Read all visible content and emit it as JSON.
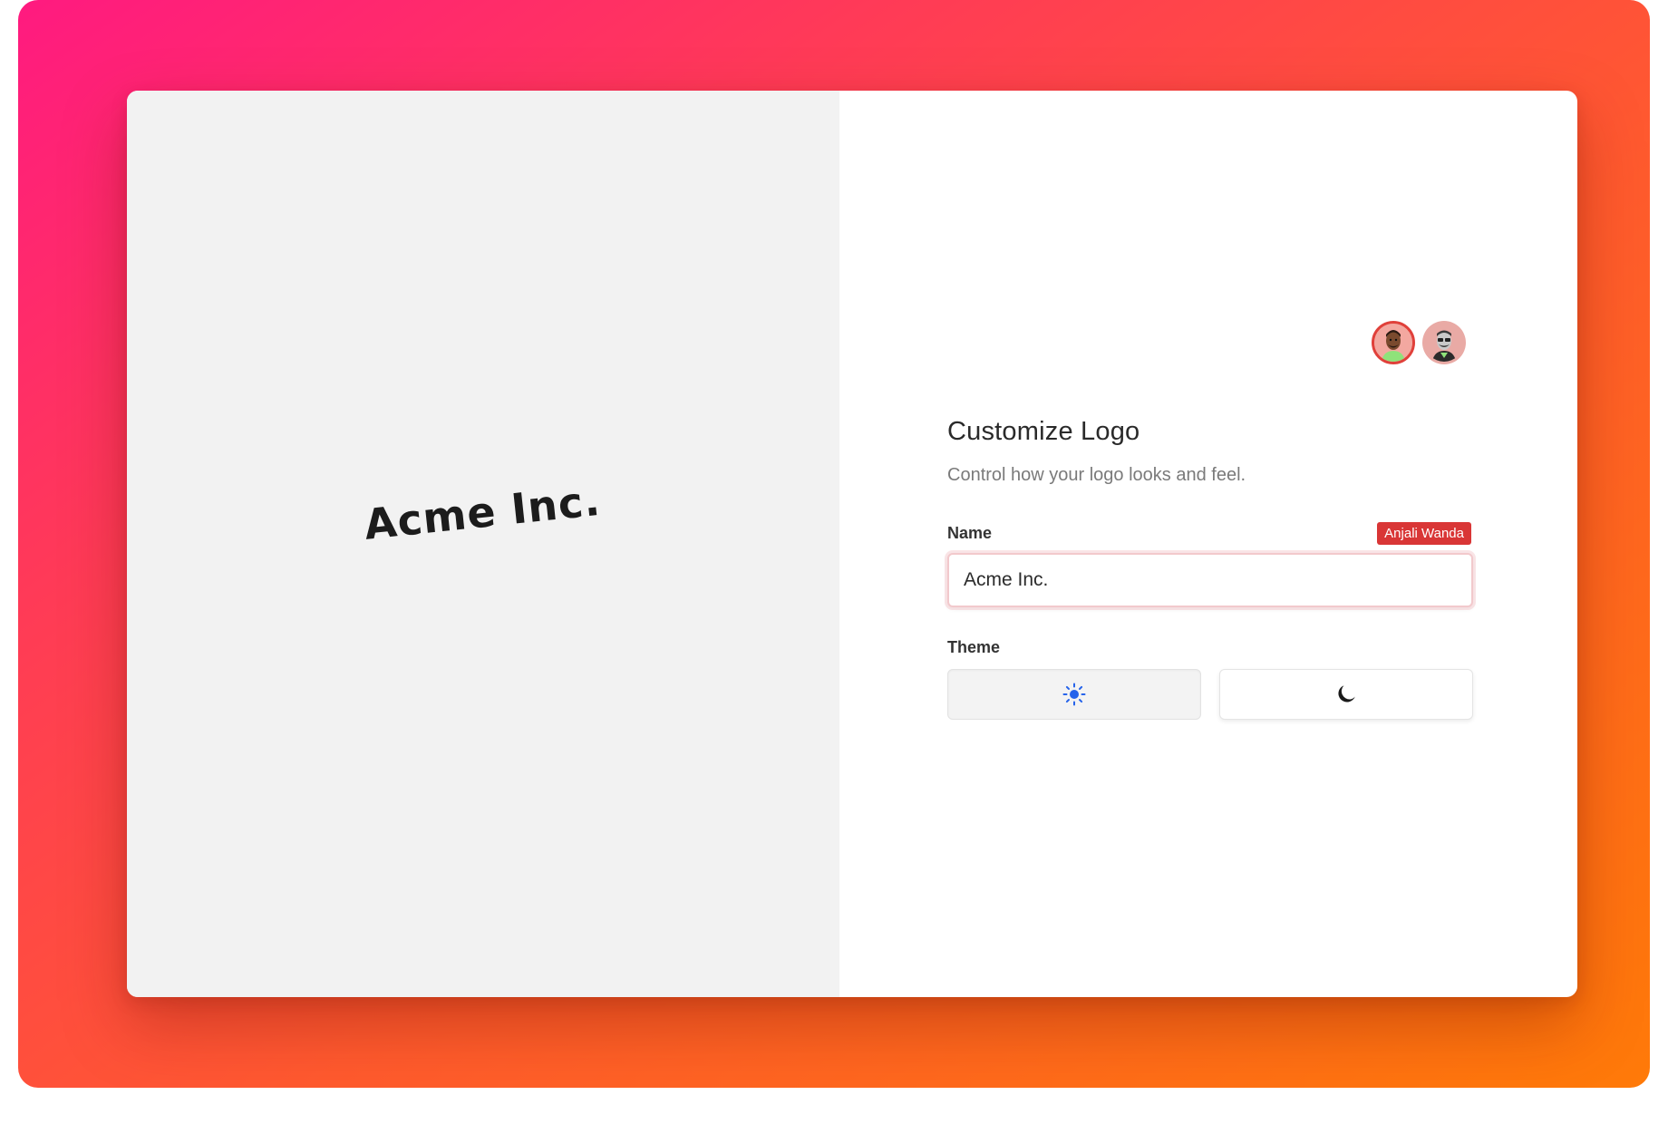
{
  "preview": {
    "logo_text": "Acme Inc."
  },
  "collaborators": [
    {
      "icon": "avatar-icon",
      "ring_color": "#e0403a"
    },
    {
      "icon": "avatar-icon"
    }
  ],
  "panel": {
    "title": "Customize Logo",
    "subtitle": "Control how your logo looks and feel."
  },
  "name_field": {
    "label": "Name",
    "value": "Acme Inc.",
    "editor_badge": "Anjali Wanda",
    "badge_color": "#d93636"
  },
  "theme": {
    "label": "Theme",
    "options": [
      {
        "icon": "sun-icon",
        "selected": true,
        "icon_color": "#2563eb"
      },
      {
        "icon": "moon-icon",
        "selected": false,
        "icon_color": "#1a1a1a"
      }
    ]
  },
  "colors": {
    "background_gradient": [
      "#ff1a80",
      "#ff5a2e",
      "#ff7a08"
    ],
    "preview_bg": "#f2f2f2"
  }
}
